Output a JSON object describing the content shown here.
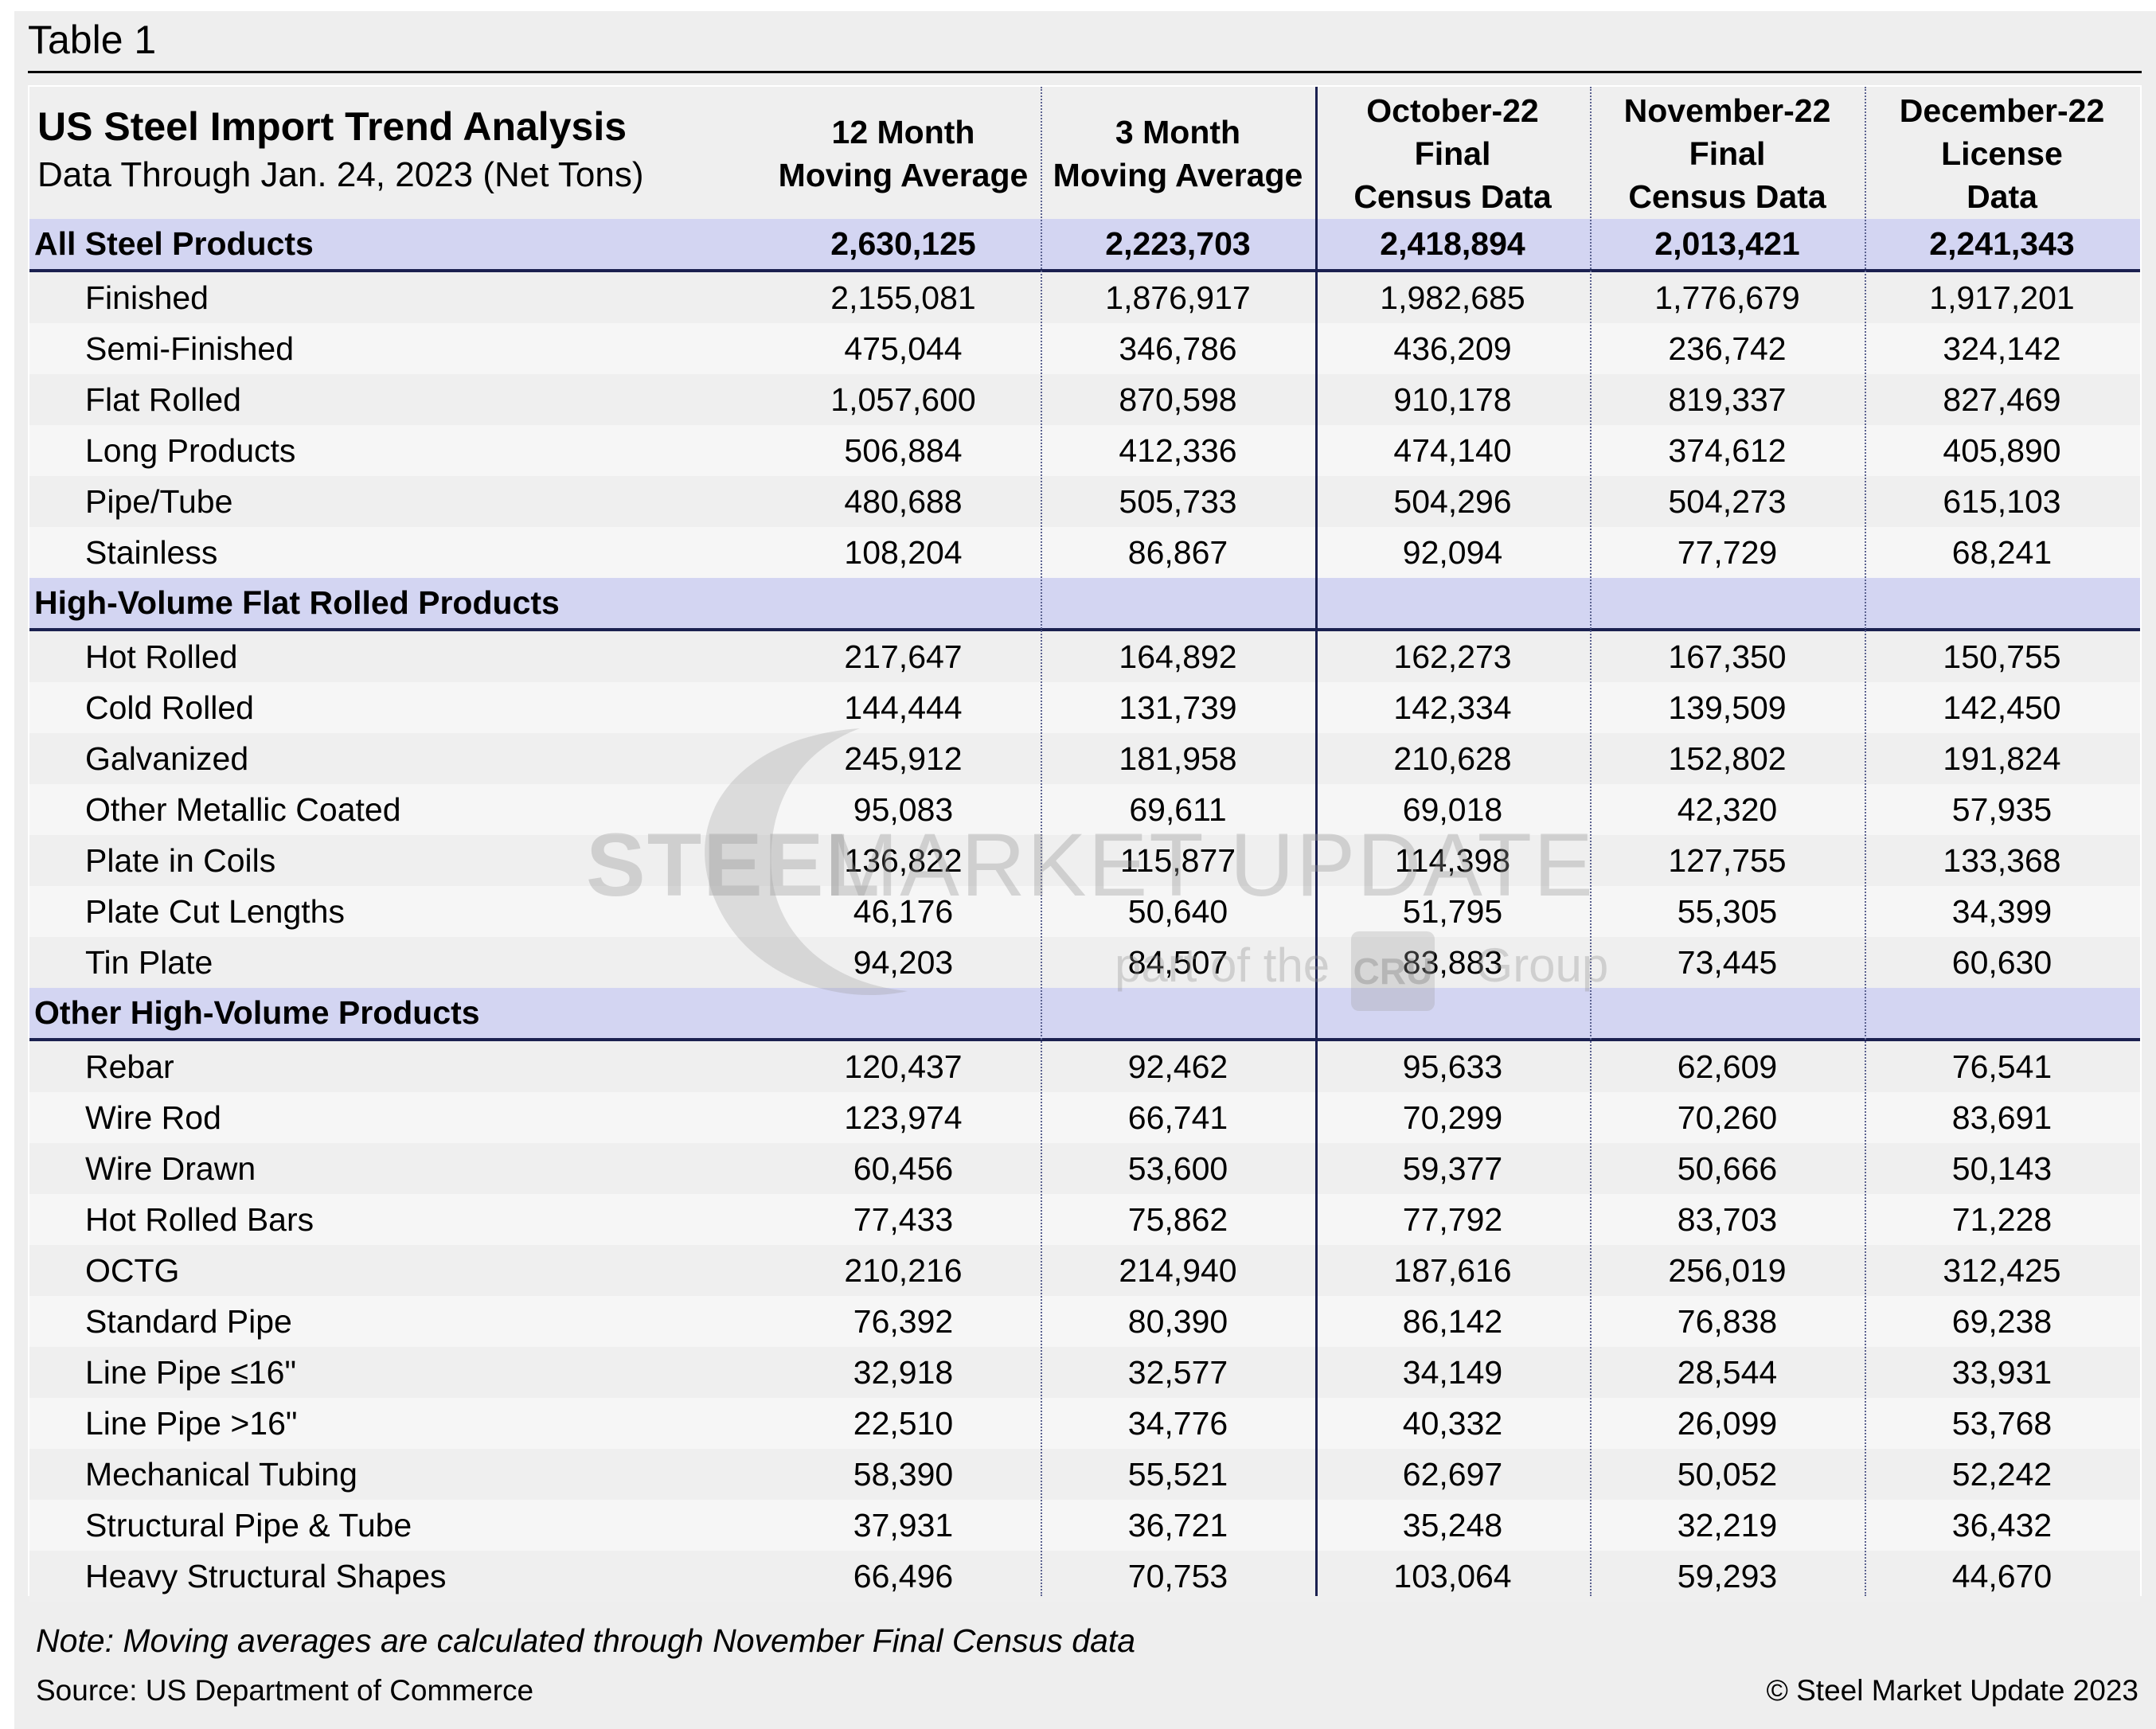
{
  "table_label": "Table 1",
  "header": {
    "title": "US Steel Import Trend Analysis",
    "subtitle": "Data Through Jan. 24, 2023 (Net Tons)",
    "columns": [
      [
        "12 Month",
        "Moving Average"
      ],
      [
        "3 Month",
        "Moving Average"
      ],
      [
        "October-22",
        "Final",
        "Census Data"
      ],
      [
        "November-22",
        "Final",
        "Census Data"
      ],
      [
        "December-22",
        "License",
        "Data"
      ]
    ]
  },
  "sections": [
    {
      "title": "All Steel Products",
      "totals": [
        "2,630,125",
        "2,223,703",
        "2,418,894",
        "2,013,421",
        "2,241,343"
      ],
      "rows": [
        {
          "label": "Finished",
          "values": [
            "2,155,081",
            "1,876,917",
            "1,982,685",
            "1,776,679",
            "1,917,201"
          ]
        },
        {
          "label": "Semi-Finished",
          "values": [
            "475,044",
            "346,786",
            "436,209",
            "236,742",
            "324,142"
          ]
        },
        {
          "label": "Flat Rolled",
          "values": [
            "1,057,600",
            "870,598",
            "910,178",
            "819,337",
            "827,469"
          ]
        },
        {
          "label": "Long Products",
          "values": [
            "506,884",
            "412,336",
            "474,140",
            "374,612",
            "405,890"
          ]
        },
        {
          "label": "Pipe/Tube",
          "values": [
            "480,688",
            "505,733",
            "504,296",
            "504,273",
            "615,103"
          ]
        },
        {
          "label": "Stainless",
          "values": [
            "108,204",
            "86,867",
            "92,094",
            "77,729",
            "68,241"
          ]
        }
      ]
    },
    {
      "title": "High-Volume Flat Rolled Products",
      "totals": [],
      "rows": [
        {
          "label": "Hot Rolled",
          "values": [
            "217,647",
            "164,892",
            "162,273",
            "167,350",
            "150,755"
          ]
        },
        {
          "label": "Cold Rolled",
          "values": [
            "144,444",
            "131,739",
            "142,334",
            "139,509",
            "142,450"
          ]
        },
        {
          "label": "Galvanized",
          "values": [
            "245,912",
            "181,958",
            "210,628",
            "152,802",
            "191,824"
          ]
        },
        {
          "label": "Other Metallic Coated",
          "values": [
            "95,083",
            "69,611",
            "69,018",
            "42,320",
            "57,935"
          ]
        },
        {
          "label": "Plate in Coils",
          "values": [
            "136,822",
            "115,877",
            "114,398",
            "127,755",
            "133,368"
          ]
        },
        {
          "label": "Plate Cut Lengths",
          "values": [
            "46,176",
            "50,640",
            "51,795",
            "55,305",
            "34,399"
          ]
        },
        {
          "label": "Tin Plate",
          "values": [
            "94,203",
            "84,507",
            "83,883",
            "73,445",
            "60,630"
          ]
        }
      ]
    },
    {
      "title": "Other High-Volume Products",
      "totals": [],
      "rows": [
        {
          "label": "Rebar",
          "values": [
            "120,437",
            "92,462",
            "95,633",
            "62,609",
            "76,541"
          ]
        },
        {
          "label": "Wire Rod",
          "values": [
            "123,974",
            "66,741",
            "70,299",
            "70,260",
            "83,691"
          ]
        },
        {
          "label": "Wire Drawn",
          "values": [
            "60,456",
            "53,600",
            "59,377",
            "50,666",
            "50,143"
          ]
        },
        {
          "label": "Hot Rolled Bars",
          "values": [
            "77,433",
            "75,862",
            "77,792",
            "83,703",
            "71,228"
          ]
        },
        {
          "label": "OCTG",
          "values": [
            "210,216",
            "214,940",
            "187,616",
            "256,019",
            "312,425"
          ]
        },
        {
          "label": "Standard Pipe",
          "values": [
            "76,392",
            "80,390",
            "86,142",
            "76,838",
            "69,238"
          ]
        },
        {
          "label": "Line Pipe ≤16\"",
          "values": [
            "32,918",
            "32,577",
            "34,149",
            "28,544",
            "33,931"
          ]
        },
        {
          "label": "Line Pipe >16\"",
          "values": [
            "22,510",
            "34,776",
            "40,332",
            "26,099",
            "53,768"
          ]
        },
        {
          "label": "Mechanical Tubing",
          "values": [
            "58,390",
            "55,521",
            "62,697",
            "50,052",
            "52,242"
          ]
        },
        {
          "label": "Structural Pipe & Tube",
          "values": [
            "37,931",
            "36,721",
            "35,248",
            "32,219",
            "36,432"
          ]
        },
        {
          "label": "Heavy Structural Shapes",
          "values": [
            "66,496",
            "70,753",
            "103,064",
            "59,293",
            "44,670"
          ]
        }
      ]
    }
  ],
  "footer": {
    "note": "Note: Moving averages are calculated through November Final Census data",
    "source": "Source: US Department of Commerce",
    "copyright": "© Steel Market Update 2023"
  },
  "watermark": {
    "brand_bold": "STEEL",
    "brand_light": "MARKET UPDATE",
    "tagline_prefix": "part of the",
    "tagline_logo": "CRU",
    "tagline_suffix": "Group"
  },
  "colors": {
    "band": "#d3d5f2",
    "navy": "#1b2150",
    "row_a": "#efefef",
    "row_b": "#f6f6f6"
  }
}
